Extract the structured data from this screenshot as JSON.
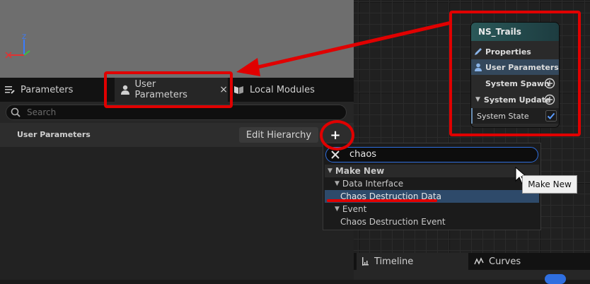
{
  "viewport": {
    "axis_z": "Z"
  },
  "tabs": [
    {
      "label": "Parameters",
      "icon": "list-icon"
    },
    {
      "label": "User Parameters",
      "icon": "user-icon",
      "close": "×"
    },
    {
      "label": "Local Modules",
      "icon": "book-icon"
    }
  ],
  "search": {
    "placeholder": "Search"
  },
  "header": {
    "title": "User Parameters",
    "edit_button": "Edit Hierarchy",
    "add_button": "+"
  },
  "menu": {
    "search_value": "chaos",
    "items": [
      {
        "label": "Make New",
        "kind": "category"
      },
      {
        "label": "Data Interface",
        "kind": "subcategory"
      },
      {
        "label": "Chaos Destruction Data",
        "kind": "item",
        "selected": true
      },
      {
        "label": "Event",
        "kind": "subcategory"
      },
      {
        "label": "Chaos Destruction Event",
        "kind": "item"
      }
    ]
  },
  "tooltip": {
    "text": "Make New"
  },
  "node": {
    "title": "NS_Trails",
    "rows": [
      "Properties",
      "User Parameters",
      "System Spawn",
      "System Update",
      "System State"
    ]
  },
  "bottom_tabs": [
    {
      "label": "Timeline"
    },
    {
      "label": "Curves"
    }
  ],
  "colors": {
    "annotation_red": "#e00000",
    "accent_blue": "#2f6fe0",
    "selection": "#2e4a6a"
  }
}
